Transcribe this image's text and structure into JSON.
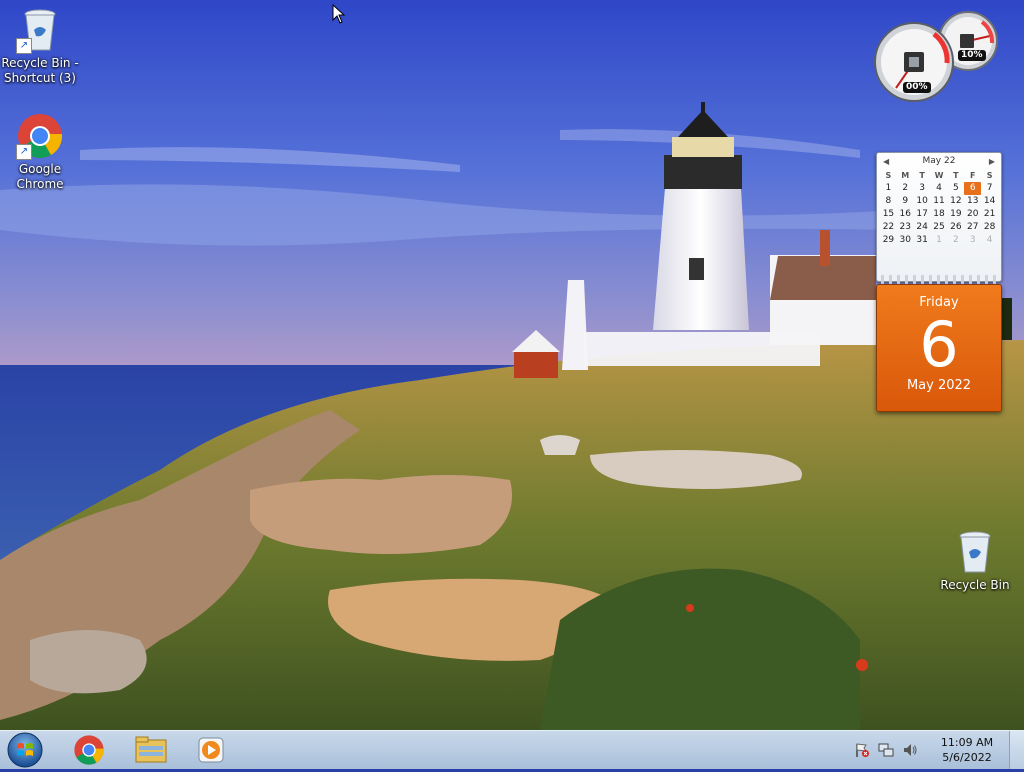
{
  "desktop": {
    "icons": [
      {
        "label": "Recycle Bin - Shortcut (3)"
      },
      {
        "label": "Google Chrome"
      },
      {
        "label": "Recycle Bin"
      }
    ]
  },
  "gadgets": {
    "cpu_meter": {
      "cpu_percent": "00%",
      "memory_percent": "10%"
    },
    "calendar": {
      "month_title": "May 22",
      "weekdays": [
        "S",
        "M",
        "T",
        "W",
        "T",
        "F",
        "S"
      ],
      "weeks": [
        [
          "1",
          "2",
          "3",
          "4",
          "5",
          "6",
          "7"
        ],
        [
          "8",
          "9",
          "10",
          "11",
          "12",
          "13",
          "14"
        ],
        [
          "15",
          "16",
          "17",
          "18",
          "19",
          "20",
          "21"
        ],
        [
          "22",
          "23",
          "24",
          "25",
          "26",
          "27",
          "28"
        ],
        [
          "29",
          "30",
          "31",
          "1",
          "2",
          "3",
          "4"
        ]
      ],
      "selected_day": "6",
      "day_name": "Friday",
      "day_number": "6",
      "month_year": "May 2022"
    }
  },
  "taskbar": {
    "pinned": [
      "start-orb",
      "chrome-icon",
      "file-explorer-icon",
      "media-player-icon"
    ],
    "clock_time": "11:09 AM",
    "clock_date": "5/6/2022"
  },
  "colors": {
    "calendar_accent": "#e8701a",
    "taskbar": "#b7cbe2"
  }
}
